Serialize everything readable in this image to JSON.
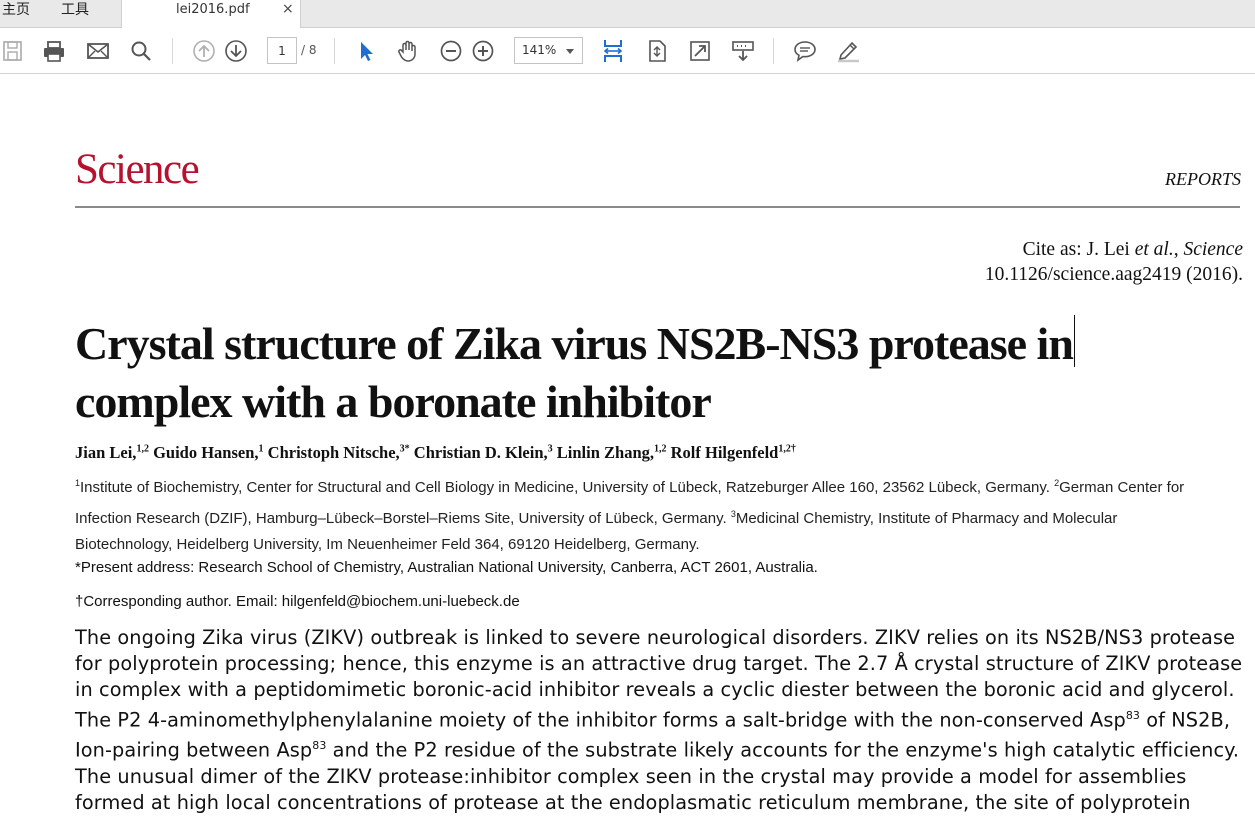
{
  "tabs": {
    "home_label": "主页",
    "tools_label": "工具",
    "document_label": "lei2016.pdf",
    "close_glyph": "×"
  },
  "toolbar": {
    "page_current": "1",
    "page_total": "/ 8",
    "zoom": "141%"
  },
  "document": {
    "journal": "Science",
    "section": "REPORTS",
    "cite_line1_prefix": "Cite as: J. Lei ",
    "cite_line1_etal": "et al.",
    "cite_line1_sep": ", ",
    "cite_line1_journal": "Science",
    "cite_line2": "10.1126/science.aag2419 (2016).",
    "title_line1": "Crystal structure of Zika virus NS2B-NS3 protease in",
    "title_line2": "complex with a boronate inhibitor",
    "authors": [
      {
        "name": "Jian Lei,",
        "sup": "1,2"
      },
      {
        "name": " Guido Hansen,",
        "sup": "1"
      },
      {
        "name": " Christoph Nitsche,",
        "sup": "3*"
      },
      {
        "name": " Christian D. Klein,",
        "sup": "3"
      },
      {
        "name": " Linlin Zhang,",
        "sup": "1,2"
      },
      {
        "name": " Rolf Hilgenfeld",
        "sup": "1,2†"
      }
    ],
    "affiliations": {
      "a1_sup": "1",
      "a1": "Institute of Biochemistry, Center for Structural and Cell Biology in Medicine, University of Lübeck, Ratzeburger Allee 160, 23562 Lübeck, Germany. ",
      "a2_sup": "2",
      "a2": "German Center for Infection Research (DZIF), Hamburg–Lübeck–Borstel–Riems Site, University of Lübeck, Germany. ",
      "a3_sup": "3",
      "a3": "Medicinal Chemistry, Institute of Pharmacy and Molecular Biotechnology, Heidelberg University, Im Neuenheimer Feld 364, 69120 Heidelberg, Germany."
    },
    "present_address": "*Present address: Research School of Chemistry, Australian National University, Canberra, ACT 2601, Australia.",
    "corresponding": "†Corresponding author. Email: hilgenfeld@biochem.uni-luebeck.de",
    "abstract": {
      "part1": "The ongoing Zika virus (ZIKV) outbreak is linked to severe neurological disorders. ZIKV relies on its NS2B/NS3 protease for polyprotein processing; hence, this enzyme is an attractive drug target. The 2.7 Å crystal structure of ZIKV protease in complex with a peptidomimetic boronic-acid inhibitor reveals a cyclic diester between the boronic acid and glycerol. The P2 4-aminomethylphenylalanine moiety of the inhibitor forms a salt-bridge with the non-conserved Asp",
      "sup1": "83",
      "part2": " of NS2B, Ion-pairing between Asp",
      "sup2": "83",
      "part3": " and the P2 residue of the substrate likely accounts for the enzyme's high catalytic efficiency. The unusual dimer of the ZIKV protease:inhibitor complex seen in the crystal may provide a model for assemblies formed at high local concentrations of protease at the endoplasmatic reticulum membrane, the site of polyprotein processing."
    }
  }
}
